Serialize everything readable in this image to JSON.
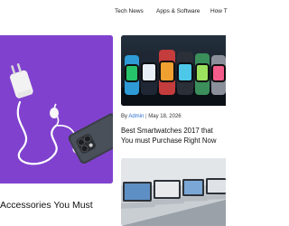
{
  "nav": {
    "items": [
      "Tech News",
      "Apps & Software",
      "How T"
    ]
  },
  "featured": {
    "title": "Accessories You Must"
  },
  "card1": {
    "author": "Admin",
    "separator": "|",
    "date": "May 18, 2026",
    "title_line1": "Best Smartwatches 2017 that",
    "title_line2": "You must Purchase Right Now"
  },
  "colors": {
    "hero_background": "#7b3ec9",
    "author_link": "#2c6fd0",
    "nav_text": "#222222"
  },
  "icons": {
    "hero_image": "phone-charger-earphones-photo",
    "card1_image": "smartwatches-photo",
    "card2_image": "laptops-photo"
  }
}
